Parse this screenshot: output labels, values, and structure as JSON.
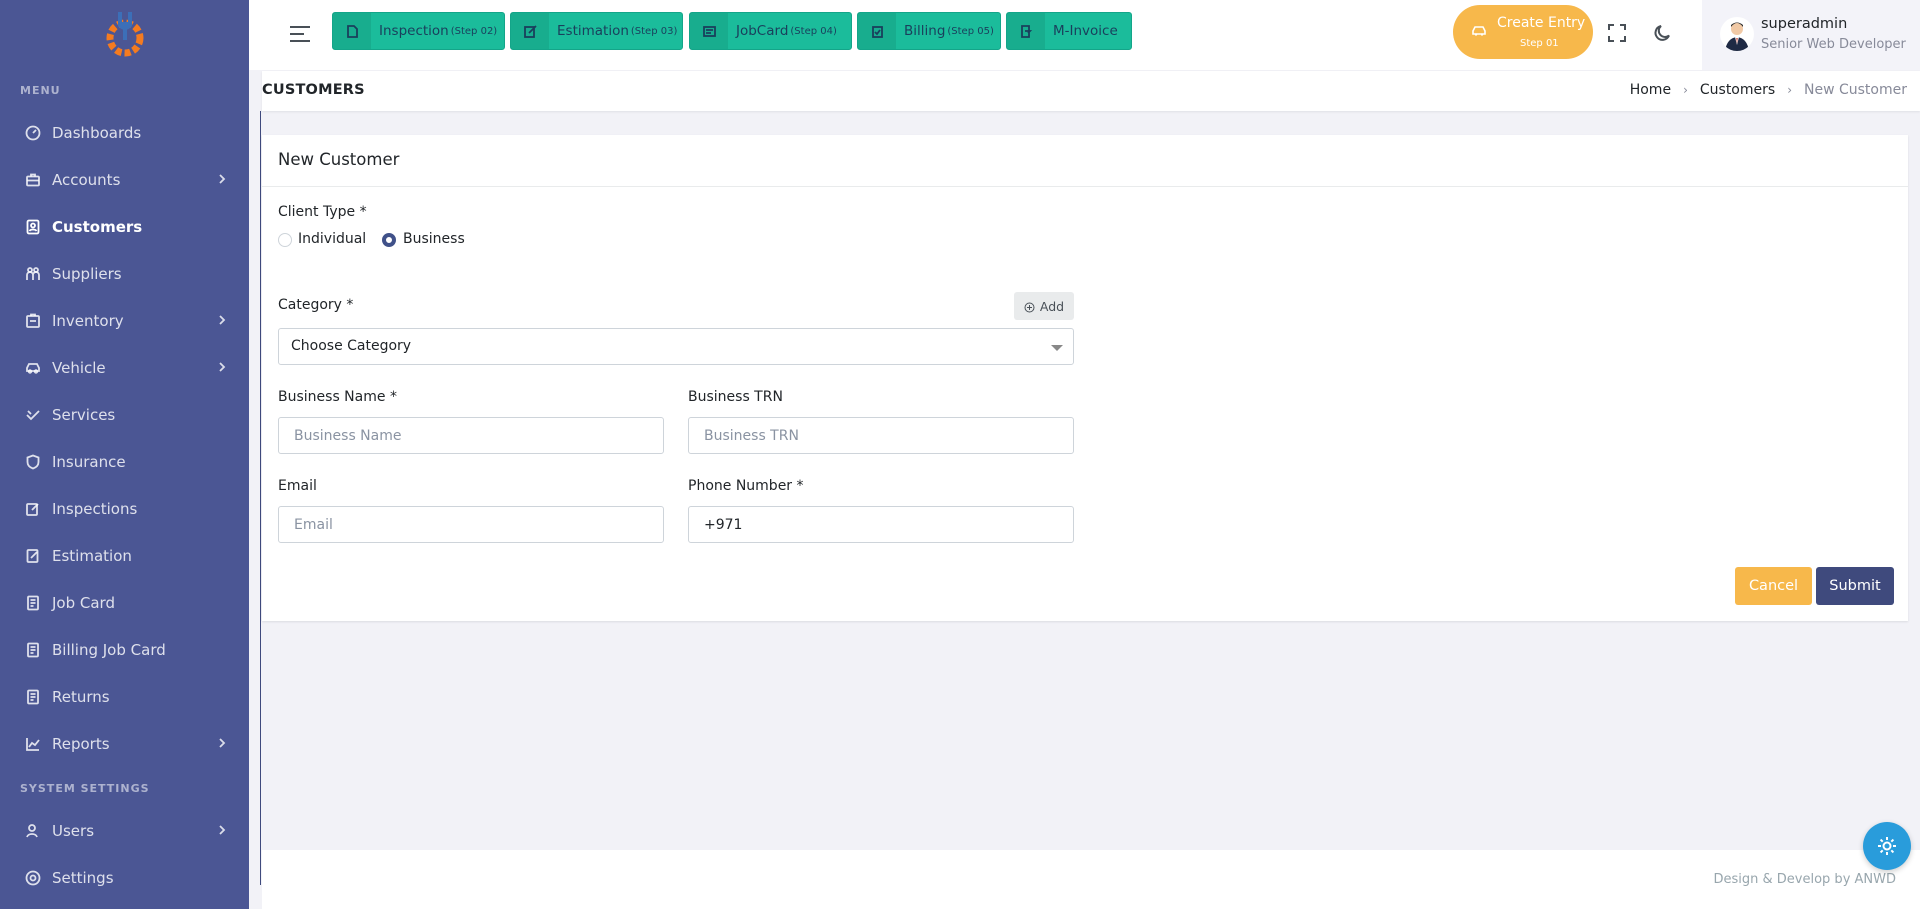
{
  "sidebar": {
    "menu_title": "MENU",
    "system_title": "SYSTEM SETTINGS",
    "items": [
      {
        "label": "Dashboards",
        "icon": "dashboard-icon",
        "chevron": false,
        "active": false
      },
      {
        "label": "Accounts",
        "icon": "briefcase-icon",
        "chevron": true,
        "active": false
      },
      {
        "label": "Customers",
        "icon": "contact-icon",
        "chevron": false,
        "active": true
      },
      {
        "label": "Suppliers",
        "icon": "people-icon",
        "chevron": false,
        "active": false
      },
      {
        "label": "Inventory",
        "icon": "inventory-icon",
        "chevron": true,
        "active": false
      },
      {
        "label": "Vehicle",
        "icon": "car-icon",
        "chevron": true,
        "active": false
      },
      {
        "label": "Services",
        "icon": "service-icon",
        "chevron": false,
        "active": false
      },
      {
        "label": "Insurance",
        "icon": "shield-icon",
        "chevron": false,
        "active": false
      },
      {
        "label": "Inspections",
        "icon": "edit-icon",
        "chevron": false,
        "active": false
      },
      {
        "label": "Estimation",
        "icon": "estimate-icon",
        "chevron": false,
        "active": false
      },
      {
        "label": "Job Card",
        "icon": "document-icon",
        "chevron": false,
        "active": false
      },
      {
        "label": "Billing Job Card",
        "icon": "document-icon",
        "chevron": false,
        "active": false
      },
      {
        "label": "Returns",
        "icon": "document-icon",
        "chevron": false,
        "active": false
      },
      {
        "label": "Reports",
        "icon": "chart-icon",
        "chevron": true,
        "active": false
      }
    ],
    "system_items": [
      {
        "label": "Users",
        "icon": "user-icon",
        "chevron": true
      },
      {
        "label": "Settings",
        "icon": "settings-icon",
        "chevron": false
      }
    ]
  },
  "topbar": {
    "steps": [
      {
        "label": "Inspection",
        "sub": "(Step 02)",
        "icon": "file-icon"
      },
      {
        "label": "Estimation",
        "sub": "(Step 03)",
        "icon": "edit-icon"
      },
      {
        "label": "JobCard",
        "sub": "(Step 04)",
        "icon": "card-icon"
      },
      {
        "label": "Billing",
        "sub": "(Step 05)",
        "icon": "clipboard-icon"
      },
      {
        "label": "M-Invoice",
        "sub": "",
        "icon": "invoice-icon"
      }
    ],
    "create_entry": {
      "label": "Create Entry",
      "sub": "Step 01"
    },
    "user": {
      "name": "superadmin",
      "role": "Senior Web Developer"
    }
  },
  "page": {
    "title": "CUSTOMERS",
    "breadcrumb": [
      "Home",
      "Customers",
      "New Customer"
    ]
  },
  "form": {
    "card_title": "New Customer",
    "client_type_label": "Client Type *",
    "client_types": [
      "Individual",
      "Business"
    ],
    "client_type_selected": "Business",
    "category_label": "Category *",
    "add_label": "Add",
    "category_value": "Choose Category",
    "business_name_label": "Business Name *",
    "business_name_placeholder": "Business Name",
    "business_trn_label": "Business TRN",
    "business_trn_placeholder": "Business TRN",
    "email_label": "Email",
    "email_placeholder": "Email",
    "phone_label": "Phone Number *",
    "phone_value": "+971",
    "cancel_label": "Cancel",
    "submit_label": "Submit"
  },
  "footer": {
    "text": "Design & Develop by ANWD"
  },
  "colors": {
    "sidebar": "#4b5694",
    "step_button": "#1bbc9b",
    "create_entry": "#f7b84b",
    "submit": "#3f4a7d",
    "fab": "#299cdb"
  }
}
